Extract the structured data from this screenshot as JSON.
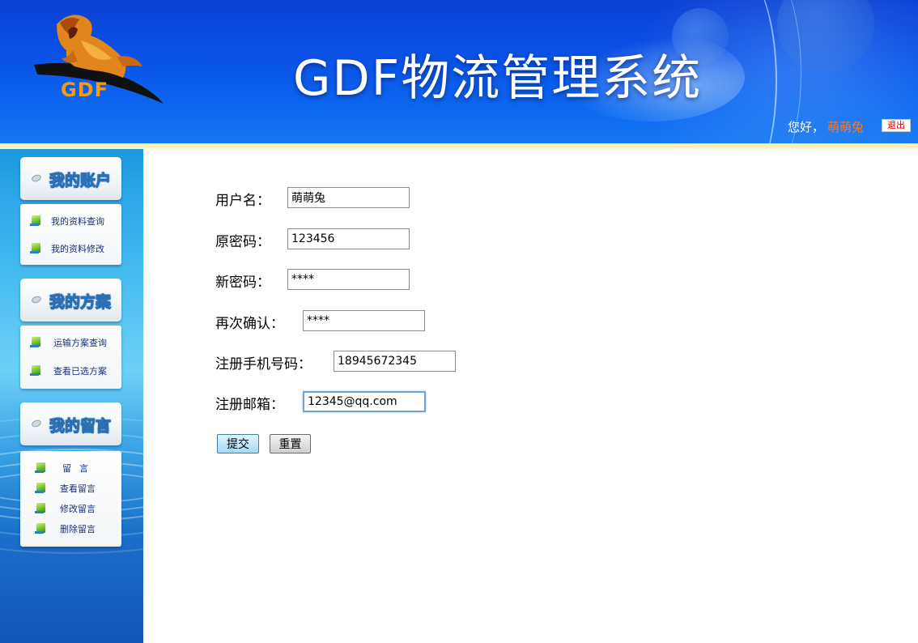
{
  "header": {
    "logo_text": "GDF",
    "system_title": "GDF物流管理系统",
    "greeting": "您好，",
    "username": "萌萌兔",
    "logout_label": "退出"
  },
  "sidebar": {
    "sections": [
      {
        "title": "我的账户",
        "items": [
          "我的资料查询",
          "我的资料修改"
        ]
      },
      {
        "title": "我的方案",
        "items": [
          "运输方案查询",
          "查看已选方案"
        ]
      },
      {
        "title": "我的留言",
        "items": [
          "留言",
          "查看留言",
          "修改留言",
          "删除留言"
        ]
      }
    ]
  },
  "form": {
    "username_label": "用户名：",
    "username_value": "萌萌兔",
    "old_password_label": "原密码：",
    "old_password_value": "123456",
    "new_password_label": "新密码：",
    "new_password_value": "****",
    "confirm_label": "再次确认：",
    "confirm_value": "****",
    "phone_label": "注册手机号码：",
    "phone_value": "18945672345",
    "email_label": "注册邮箱：",
    "email_value": "12345@qq.com",
    "submit_label": "提交",
    "reset_label": "重置"
  },
  "colors": {
    "header_blue": "#0b52e6",
    "username_orange": "#ff7a1a",
    "logo_orange": "#f39a1b",
    "sidebar_link": "#1a2f7a"
  }
}
